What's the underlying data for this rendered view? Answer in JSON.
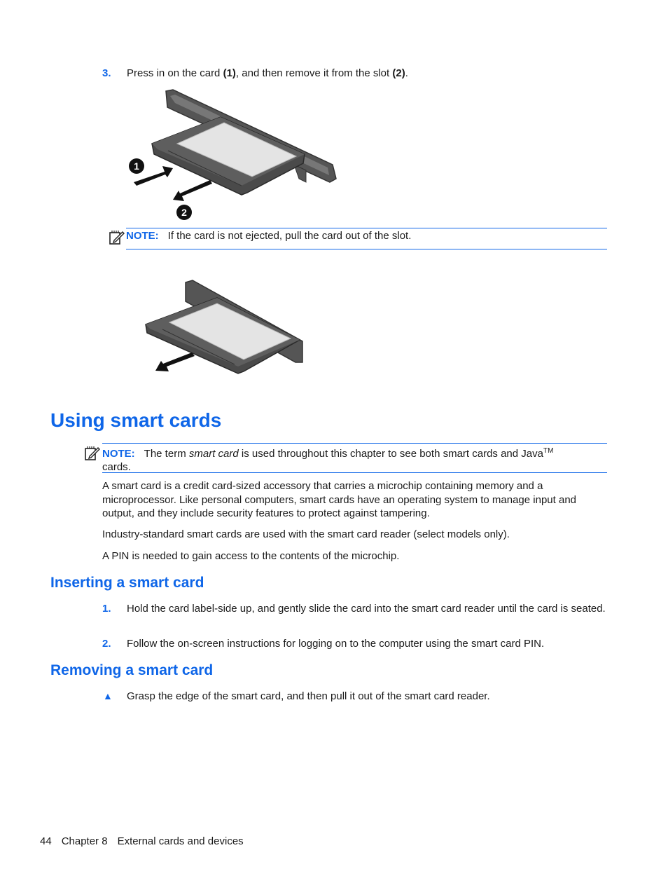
{
  "step3": {
    "number": "3.",
    "text_before_1": "Press in on the card ",
    "ref1": "(1)",
    "text_middle": ", and then remove it from the slot ",
    "ref2": "(2)",
    "text_end": "."
  },
  "figure1": {
    "callout1": "1",
    "callout2": "2"
  },
  "note1": {
    "label": "NOTE:",
    "text": "If the card is not ejected, pull the card out of the slot."
  },
  "section": {
    "title": "Using smart cards",
    "note": {
      "label": "NOTE:",
      "text_before": "The term ",
      "italic": "smart card",
      "text_after": " is used throughout this chapter to see both smart cards and Java",
      "superscript": "TM",
      "text_end": "cards."
    },
    "paragraphs": [
      "A smart card is a credit card-sized accessory that carries a microchip containing memory and a microprocessor. Like personal computers, smart cards have an operating system to manage input and output, and they include security features to protect against tampering.",
      "Industry-standard smart cards are used with the smart card reader (select models only).",
      "A PIN is needed to gain access to the contents of the microchip."
    ]
  },
  "inserting": {
    "title": "Inserting a smart card",
    "steps": [
      {
        "number": "1.",
        "text": "Hold the card label-side up, and gently slide the card into the smart card reader until the card is seated."
      },
      {
        "number": "2.",
        "text": "Follow the on-screen instructions for logging on to the computer using the smart card PIN."
      }
    ]
  },
  "removing": {
    "title": "Removing a smart card",
    "bullet": "▲",
    "text": "Grasp the edge of the smart card, and then pull it out of the smart card reader."
  },
  "footer": {
    "page_number": "44",
    "chapter": "Chapter 8",
    "chapter_title": "External cards and devices"
  }
}
